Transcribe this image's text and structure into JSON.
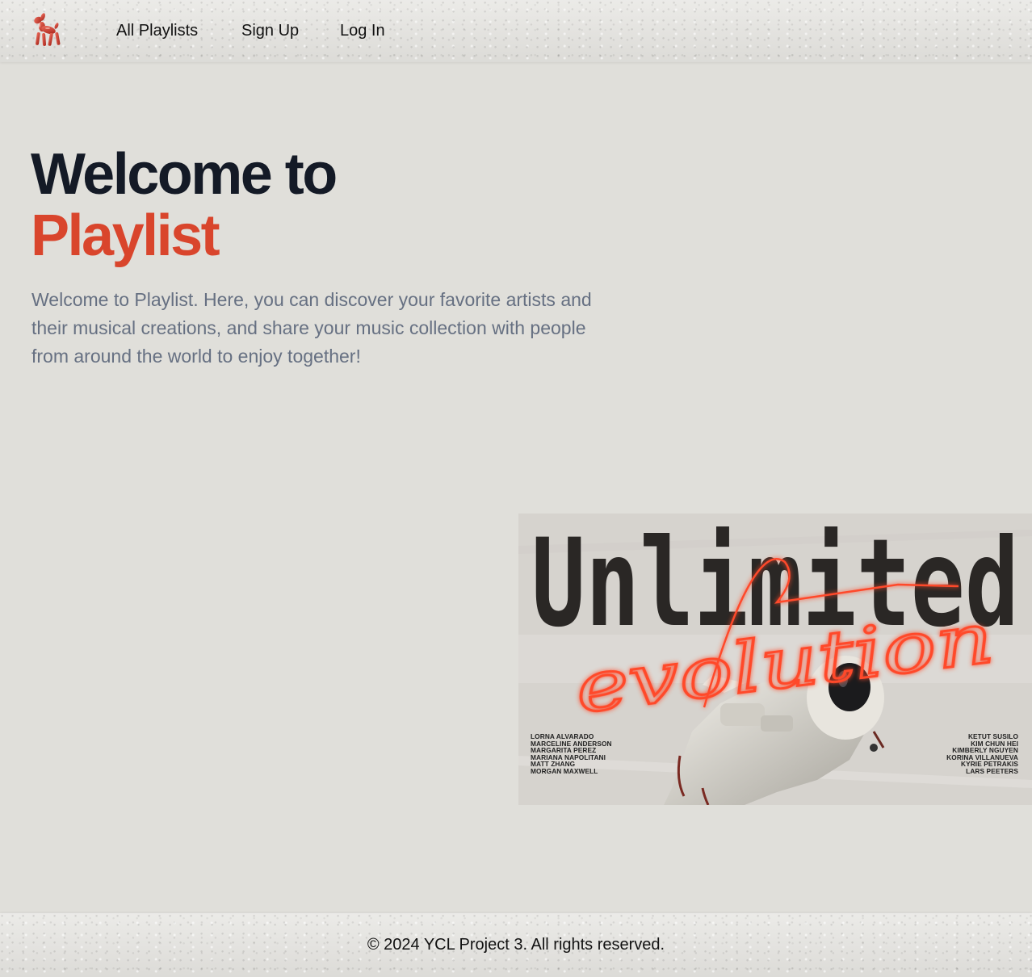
{
  "nav": {
    "logo_icon": "balloon-dog-icon",
    "links": [
      "All Playlists",
      "Sign Up",
      "Log In"
    ]
  },
  "hero": {
    "title_line1": "Welcome to",
    "title_brand": "Playlist",
    "description": "Welcome to Playlist. Here, you can discover your favorite artists and their musical creations, and share your music collection with people from around the world to enjoy together!"
  },
  "poster": {
    "headline": "Unlimited",
    "script_text": "evolution",
    "names_left": [
      "LORNA ALVARADO",
      "MARCELINE ANDERSON",
      "MARGARITA PEREZ",
      "MARIANA NAPOLITANI",
      "MATT ZHANG",
      "MORGAN MAXWELL"
    ],
    "names_right": [
      "KETUT SUSILO",
      "KIM CHUN HEI",
      "KIMBERLY NGUYEN",
      "KORINA VILLANUEVA",
      "KYRIE PETRAKIS",
      "LARS PEETERS"
    ]
  },
  "footer": {
    "copyright": "© 2024 YCL Project 3. All rights reserved."
  },
  "colors": {
    "brand": "#d9452c",
    "title": "#141a26",
    "body_text": "#667082",
    "background": "#e0dfda"
  }
}
